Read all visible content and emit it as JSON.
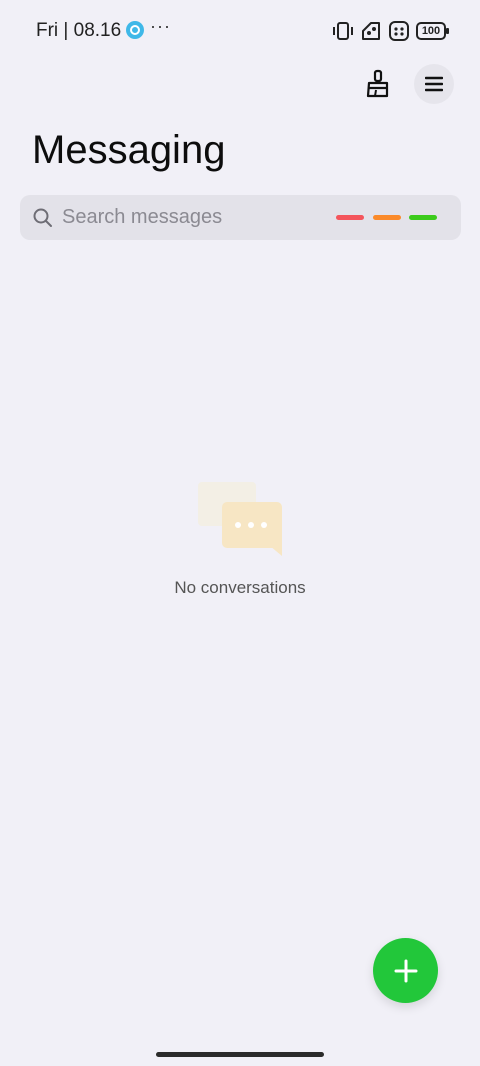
{
  "status_bar": {
    "time": "Fri | 08.16",
    "more": "···",
    "battery": "100"
  },
  "header": {
    "title": "Messaging"
  },
  "search": {
    "placeholder": "Search messages",
    "filter_colors": [
      "#f4555c",
      "#fb8a2a",
      "#3ccb1c"
    ]
  },
  "empty_state": {
    "text": "No conversations"
  },
  "colors": {
    "background": "#f1f0f7",
    "accent": "#22c73a"
  }
}
